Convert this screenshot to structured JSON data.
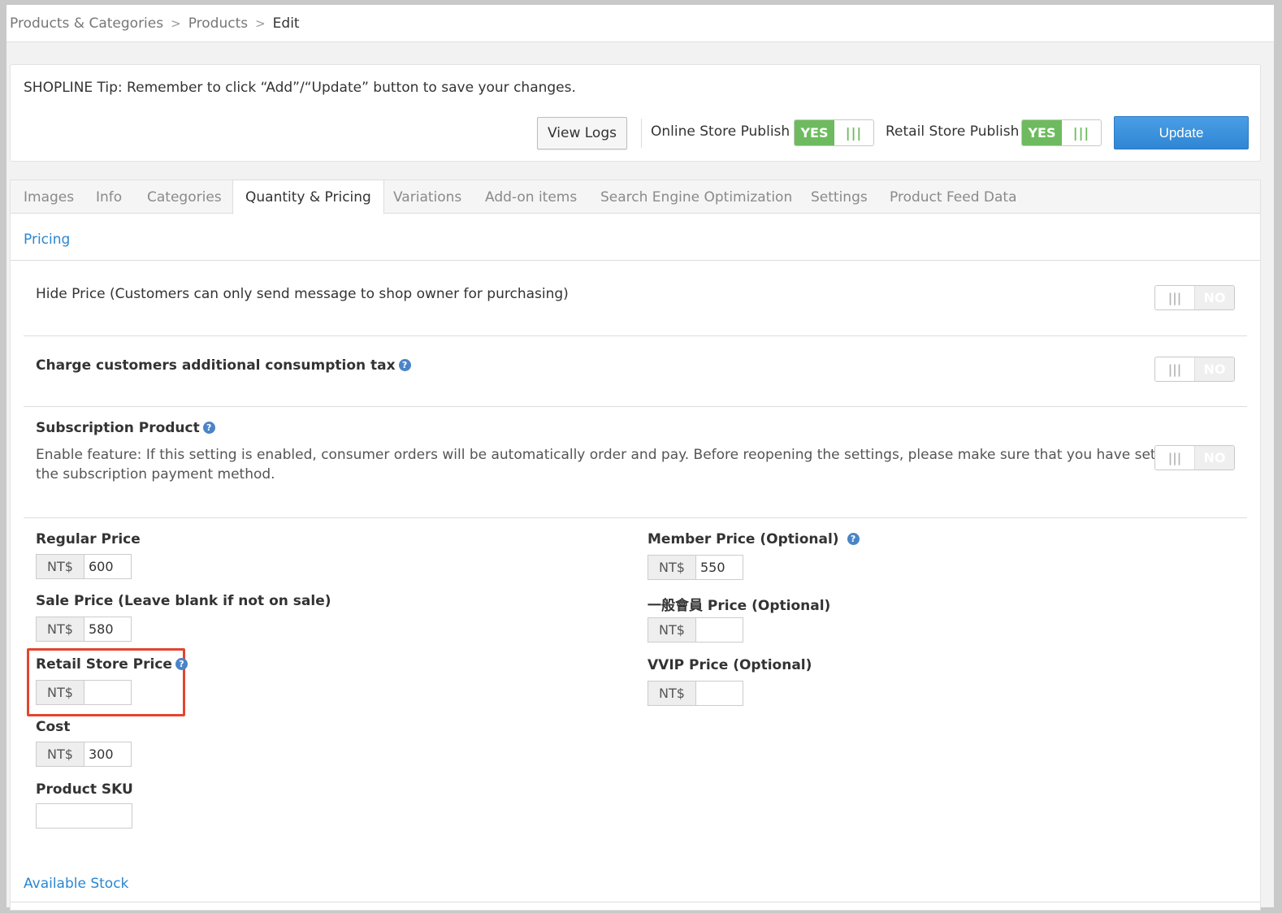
{
  "breadcrumb": {
    "items": [
      "Products & Categories",
      "Products"
    ],
    "current": "Edit",
    "separator": ">"
  },
  "tip": {
    "text": "SHOPLINE Tip: Remember to click “Add”/“Update” button to save your changes."
  },
  "toolbar": {
    "view_logs_label": "View Logs",
    "online_publish_label": "Online Store Publish",
    "online_publish_state": "YES",
    "retail_publish_label": "Retail Store Publish",
    "retail_publish_state": "YES",
    "toggle_grip": "|||",
    "update_label": "Update"
  },
  "tabs": [
    {
      "label": "Images"
    },
    {
      "label": "Info"
    },
    {
      "label": "Categories"
    },
    {
      "label": "Quantity & Pricing",
      "active": true
    },
    {
      "label": "Variations"
    },
    {
      "label": "Add-on items"
    },
    {
      "label": "Search Engine Optimization"
    },
    {
      "label": "Settings"
    },
    {
      "label": "Product Feed Data"
    }
  ],
  "pricing": {
    "section_title": "Pricing",
    "hide_price": {
      "label": "Hide Price (Customers can only send message to shop owner for purchasing)",
      "state": "NO"
    },
    "consumption_tax": {
      "label": "Charge customers additional consumption tax",
      "state": "NO"
    },
    "subscription": {
      "label": "Subscription Product",
      "description": "Enable feature: If this setting is enabled, consumer orders will be automatically order and pay. Before reopening the settings, please make sure that you have set the subscription payment method.",
      "state": "NO"
    },
    "help_glyph": "?",
    "currency": "NT$",
    "fields_left": [
      {
        "label": "Regular Price",
        "value": "600"
      },
      {
        "label": "Sale Price (Leave blank if not on sale)",
        "value": "580"
      },
      {
        "label": "Retail Store Price",
        "value": ""
      },
      {
        "label": "Cost",
        "value": "300"
      }
    ],
    "sku_label": "Product SKU",
    "sku_value": "",
    "fields_right": [
      {
        "label": "Member Price (Optional)",
        "value": "550"
      },
      {
        "label": "一般會員 Price (Optional)",
        "value": ""
      },
      {
        "label": "VVIP Price (Optional)",
        "value": ""
      }
    ]
  },
  "stock": {
    "section_title": "Available Stock"
  },
  "colors": {
    "accent_blue": "#2a86d1",
    "toggle_green": "#6dbb5e",
    "highlight_red": "#e3452f"
  }
}
